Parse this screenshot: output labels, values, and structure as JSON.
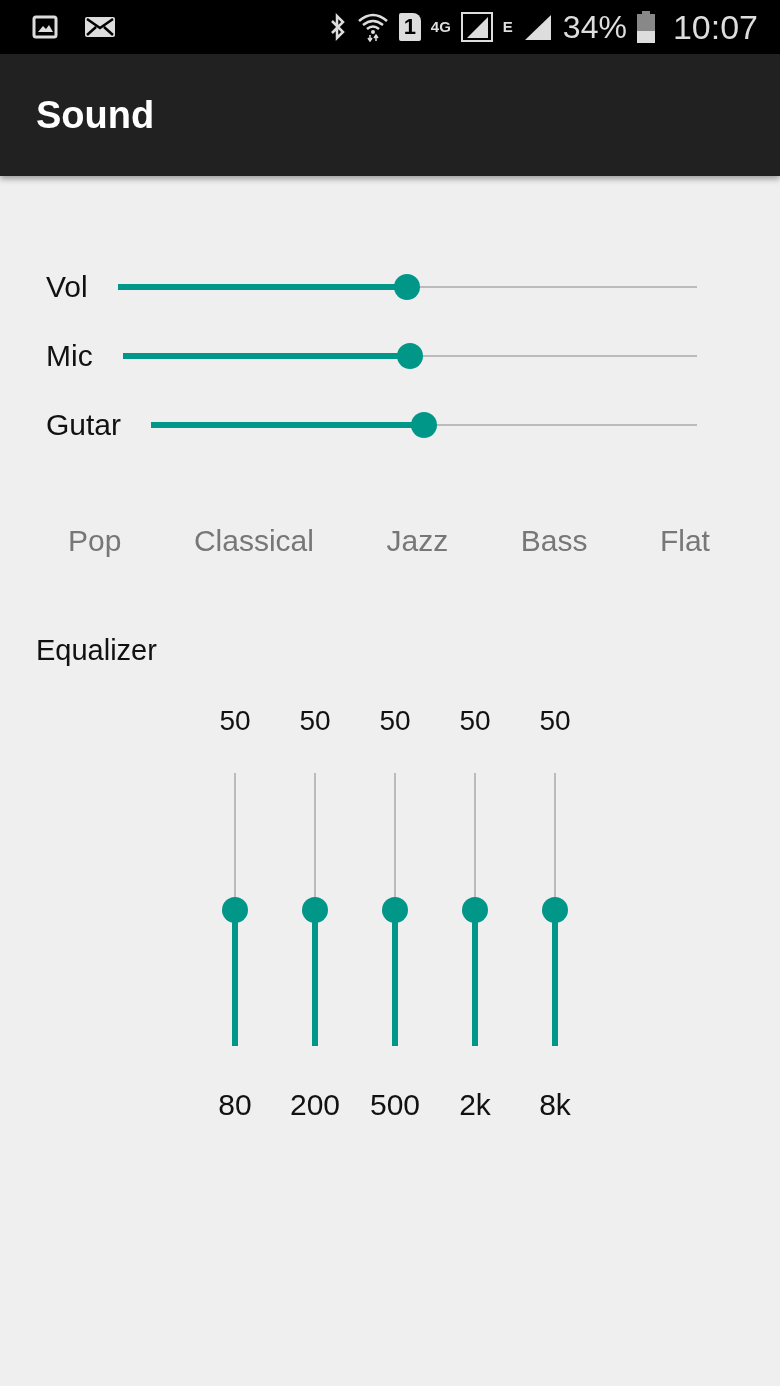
{
  "status_bar": {
    "sim_slot": "1",
    "network": "4G",
    "data_type": "E",
    "battery": "34%",
    "time": "10:07"
  },
  "app_bar": {
    "title": "Sound"
  },
  "sliders": [
    {
      "label": "Vol",
      "level": 0.5
    },
    {
      "label": "Mic",
      "level": 0.5
    },
    {
      "label": "Gutar",
      "level": 0.5
    }
  ],
  "presets": [
    "Pop",
    "Classical",
    "Jazz",
    "Bass",
    "Flat"
  ],
  "equalizer": {
    "title": "Equalizer",
    "bands": [
      {
        "value": "50",
        "frequency": "80",
        "level": 0.5
      },
      {
        "value": "50",
        "frequency": "200",
        "level": 0.5
      },
      {
        "value": "50",
        "frequency": "500",
        "level": 0.5
      },
      {
        "value": "50",
        "frequency": "2k",
        "level": 0.5
      },
      {
        "value": "50",
        "frequency": "8k",
        "level": 0.5
      }
    ]
  }
}
